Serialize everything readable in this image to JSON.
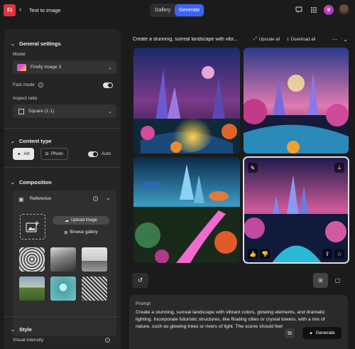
{
  "app": {
    "logo_text": "Fi",
    "title": "Text to image"
  },
  "top_tabs": [
    "Gallery",
    "Generate"
  ],
  "general_settings": {
    "title": "General settings",
    "model_label": "Model",
    "model_value": "Firefly Image 3",
    "fast_mode_label": "Fast mode",
    "fast_mode_on": true,
    "aspect_label": "Aspect ratio",
    "aspect_value": "Square (1:1)"
  },
  "content_type": {
    "title": "Content type",
    "options": [
      "Art",
      "Photo"
    ],
    "selected": "Art",
    "auto_label": "Auto",
    "auto_on": true
  },
  "composition": {
    "title": "Composition",
    "reference_label": "Reference",
    "upload_label": "Upload image",
    "browse_label": "Browse gallery"
  },
  "style": {
    "title": "Style",
    "visual_intensity_label": "Visual intensity"
  },
  "main": {
    "prompt_preview": "Create a stunning, surreal landscape with vibr...",
    "upscale_label": "Upscale all",
    "download_label": "Download all"
  },
  "prompt": {
    "label": "Prompt",
    "text": "Create a stunning, surreal landscape with vibrant colors, glowing elements, and dramatic lighting. Incorporate futuristic structures, like floating cities or crystal towers, with a mix of nature, such as glowing trees or rivers of light. The scene should feel"
  },
  "generate_label": "Generate",
  "icons": {
    "back": "chevron-left-icon",
    "chat": "chat-icon",
    "apps": "apps-icon",
    "history": "history-icon",
    "grid": "grid-view-icon",
    "single": "single-view-icon"
  }
}
